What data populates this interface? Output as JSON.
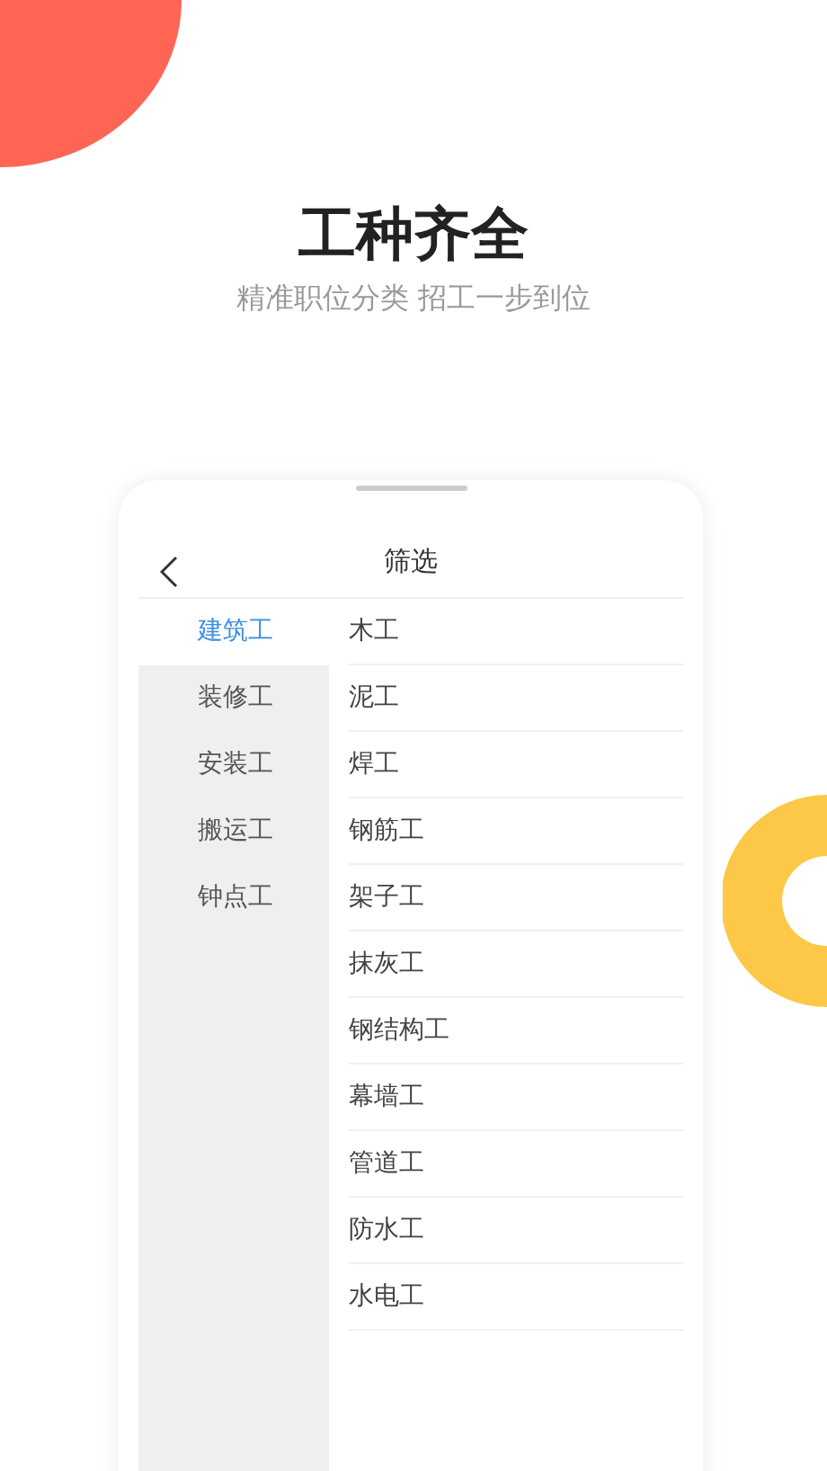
{
  "headline": "工种齐全",
  "subtitle": "精准职位分类 招工一步到位",
  "screen": {
    "title": "筛选",
    "categories": [
      {
        "label": "建筑工",
        "selected": true
      },
      {
        "label": "装修工",
        "selected": false
      },
      {
        "label": "安装工",
        "selected": false
      },
      {
        "label": "搬运工",
        "selected": false
      },
      {
        "label": "钟点工",
        "selected": false
      }
    ],
    "trades": [
      "木工",
      "泥工",
      "焊工",
      "钢筋工",
      "架子工",
      "抹灰工",
      "钢结构工",
      "幕墙工",
      "管道工",
      "防水工",
      "水电工"
    ]
  }
}
